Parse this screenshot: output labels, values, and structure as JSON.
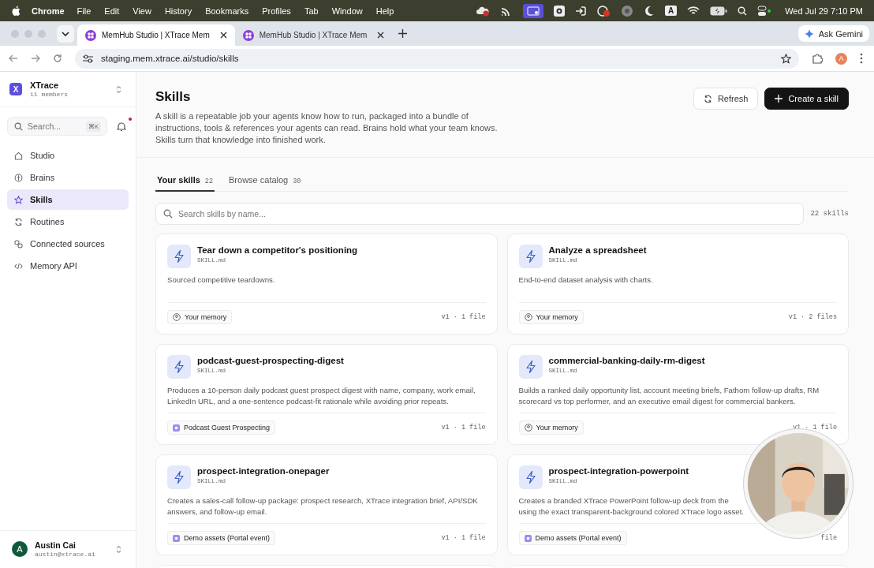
{
  "menubar": {
    "app": "Chrome",
    "menus": [
      "File",
      "Edit",
      "View",
      "History",
      "Bookmarks",
      "Profiles",
      "Tab",
      "Window",
      "Help"
    ],
    "input_source": "A",
    "clock": "Wed Jul 29  7:10 PM"
  },
  "browser": {
    "tabs": [
      {
        "title": "MemHub Studio | XTrace Mem",
        "selected": true
      },
      {
        "title": "MemHub Studio | XTrace Mem",
        "selected": false
      }
    ],
    "assistant": "Ask Gemini",
    "url": "staging.mem.xtrace.ai/studio/skills",
    "profile": "A"
  },
  "sidebar": {
    "workspace": {
      "initial": "X",
      "name": "XTrace",
      "members": "11 members"
    },
    "search": {
      "placeholder": "Search...",
      "shortcut": "⌘K"
    },
    "has_unread": true,
    "nav": [
      {
        "label": "Studio",
        "selected": false
      },
      {
        "label": "Brains",
        "selected": false
      },
      {
        "label": "Skills",
        "selected": true
      },
      {
        "label": "Routines",
        "selected": false
      },
      {
        "label": "Connected sources",
        "selected": false
      },
      {
        "label": "Memory API",
        "selected": false
      }
    ],
    "user": {
      "initial": "A",
      "name": "Austin Cai",
      "email": "austin@xtrace.ai"
    }
  },
  "page": {
    "title": "Skills",
    "description": "A skill is a repeatable job your agents know how to run, packaged into a bundle of instructions, tools & references your agents can read. Brains hold what your team knows. Skills turn that knowledge into finished work.",
    "actions": [
      {
        "label": "Refresh",
        "kind": "secondary"
      },
      {
        "label": "Create a skill",
        "kind": "primary"
      }
    ],
    "tabs": [
      {
        "label": "Your skills",
        "count": "22",
        "selected": true
      },
      {
        "label": "Browse catalog",
        "count": "30",
        "selected": false
      }
    ],
    "search": {
      "placeholder": "Search skills by name..."
    },
    "result_count": "22 skills",
    "skills": [
      {
        "name": "Tear down a competitor's positioning",
        "file": "SKILL.md",
        "lines": [
          "Sourced competitive teardowns."
        ],
        "source": {
          "label": "Your memory",
          "kind": "memory"
        },
        "meta": "v1 · 1 file"
      },
      {
        "name": "Analyze a spreadsheet",
        "file": "SKILL.md",
        "lines": [
          "End-to-end dataset analysis with charts."
        ],
        "source": {
          "label": "Your memory",
          "kind": "memory"
        },
        "meta": "v1 · 2 files"
      },
      {
        "name": "podcast-guest-prospecting-digest",
        "file": "SKILL.md",
        "lines": [
          "Produces a 10-person daily podcast guest prospect digest with name, company, work email,",
          "LinkedIn URL, and a one-sentence podcast-fit rationale while avoiding prior repeats."
        ],
        "source": {
          "label": "Podcast Guest Prospecting",
          "kind": "group"
        },
        "meta": "v1 · 1 file"
      },
      {
        "name": "commercial-banking-daily-rm-digest",
        "file": "SKILL.md",
        "lines": [
          "Builds a ranked daily opportunity list, account meeting briefs, Fathom follow-up drafts, RM",
          "scorecard vs top performer, and an executive email digest for commercial bankers."
        ],
        "source": {
          "label": "Your memory",
          "kind": "memory"
        },
        "meta": "v1 · 1 file"
      },
      {
        "name": "prospect-integration-onepager",
        "file": "SKILL.md",
        "lines": [
          "Creates a sales-call follow-up package: prospect research, XTrace integration brief, API/SDK",
          "answers, and follow-up email."
        ],
        "source": {
          "label": "Demo assets (Portal event)",
          "kind": "group"
        },
        "meta": "v1 · 1 file"
      },
      {
        "name": "prospect-integration-powerpoint",
        "file": "SKILL.md",
        "lines": [
          "Creates a branded XTrace PowerPoint follow-up deck from the",
          "using the exact transparent-background colored XTrace logo asset."
        ],
        "source": {
          "label": "Demo assets (Portal event)",
          "kind": "group"
        },
        "meta": "file"
      }
    ]
  }
}
